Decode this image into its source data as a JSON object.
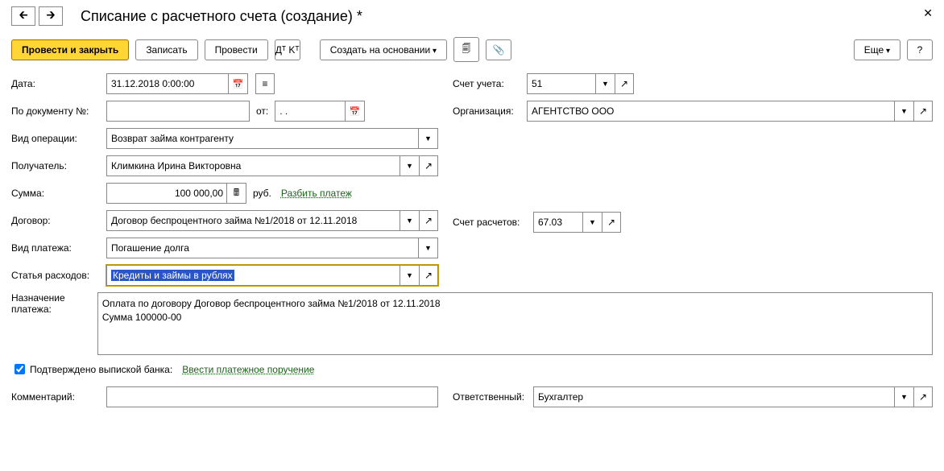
{
  "title": "Списание с расчетного счета (создание) *",
  "toolbar": {
    "submit_close": "Провести и закрыть",
    "save": "Записать",
    "submit": "Провести",
    "create_based": "Создать на основании",
    "more": "Еще",
    "help": "?"
  },
  "labels": {
    "date": "Дата:",
    "by_doc": "По документу №:",
    "from": "от:",
    "op_type": "Вид операции:",
    "recipient": "Получатель:",
    "amount": "Сумма:",
    "currency": "руб.",
    "split": "Разбить платеж",
    "contract": "Договор:",
    "pay_type": "Вид платежа:",
    "expense": "Статья расходов:",
    "purpose": "Назначение платежа:",
    "confirm": "Подтверждено выпиской банка:",
    "enter_order": "Ввести платежное поручение",
    "comment": "Комментарий:",
    "account": "Счет учета:",
    "org": "Организация:",
    "settle_acc": "Счет расчетов:",
    "responsible": "Ответственный:"
  },
  "values": {
    "date": "31.12.2018  0:00:00",
    "doc_no": "",
    "doc_date": ". .",
    "op_type": "Возврат займа контрагенту",
    "recipient": "Климкина Ирина Викторовна",
    "amount": "100 000,00",
    "contract": "Договор беспроцентного займа №1/2018 от 12.11.2018",
    "pay_type": "Погашение долга",
    "expense": "Кредиты и займы в рублях",
    "purpose": "Оплата по договору Договор беспроцентного займа №1/2018 от 12.11.2018\nСумма 100000-00",
    "comment": "",
    "account": "51",
    "org": "АГЕНТСТВО ООО",
    "settle_acc": "67.03",
    "responsible": "Бухгалтер",
    "confirm": true
  }
}
